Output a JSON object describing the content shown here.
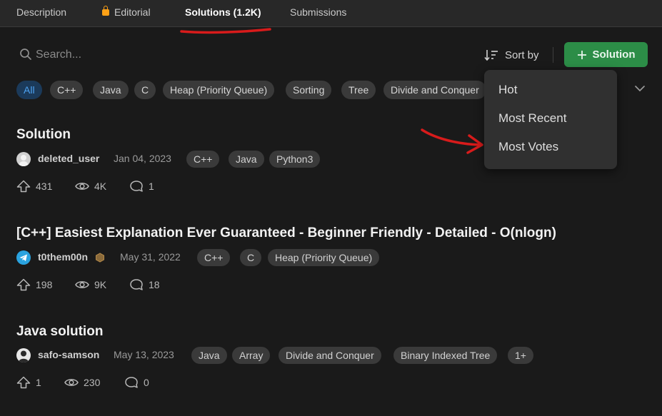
{
  "tabs": [
    {
      "label": "Description"
    },
    {
      "label": "Editorial",
      "icon": "lock-icon"
    },
    {
      "label": "Solutions (1.2K)",
      "active": true
    },
    {
      "label": "Submissions"
    }
  ],
  "toolbar": {
    "search_placeholder": "Search...",
    "sort_label": "Sort by",
    "new_solution_label": "Solution"
  },
  "filter_tags": [
    "All",
    "C++",
    "Java",
    "C",
    "Heap (Priority Queue)",
    "Sorting",
    "Tree",
    "Divide and Conquer"
  ],
  "sort_menu": [
    "Hot",
    "Most Recent",
    "Most Votes"
  ],
  "solutions": [
    {
      "title": "Solution",
      "author": "deleted_user",
      "date": "Jan 04, 2023",
      "tags": [
        "C++",
        "Java",
        "Python3"
      ],
      "upvotes": "431",
      "views": "4K",
      "comments": "1"
    },
    {
      "title": "[C++] Easiest Explanation Ever Guaranteed - Beginner Friendly - Detailed - O(nlogn)",
      "author": "t0them00n",
      "date": "May 31, 2022",
      "tags": [
        "C++",
        "C",
        "Heap (Priority Queue)"
      ],
      "upvotes": "198",
      "views": "9K",
      "comments": "18"
    },
    {
      "title": "Java solution",
      "author": "safo-samson",
      "date": "May 13, 2023",
      "tags": [
        "Java",
        "Array",
        "Divide and Conquer",
        "Binary Indexed Tree",
        "1+"
      ],
      "upvotes": "1",
      "views": "230",
      "comments": "0"
    }
  ],
  "colors": {
    "accent_green": "#2c8d47",
    "active_chip": "#4ea3f1",
    "annotation_red": "#d81b1b",
    "lock": "#ffa116"
  }
}
